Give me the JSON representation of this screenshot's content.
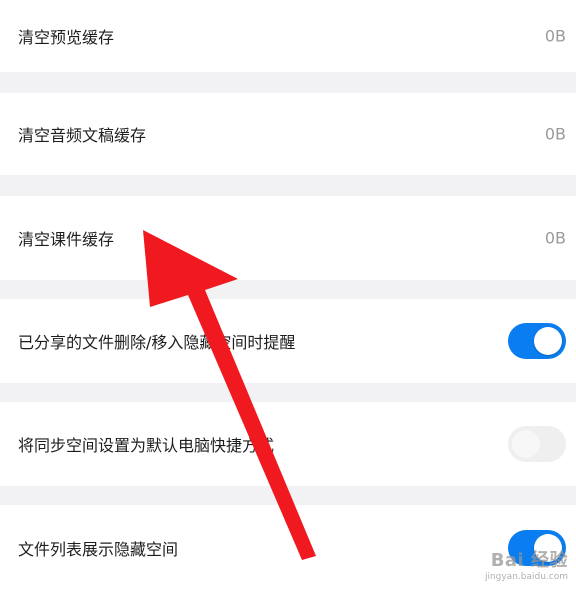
{
  "settings": {
    "items": [
      {
        "label": "清空预览缓存",
        "value": "0B"
      },
      {
        "label": "清空音频文稿缓存",
        "value": "0B"
      },
      {
        "label": "清空课件缓存",
        "value": "0B"
      },
      {
        "label": "已分享的文件删除/移入隐藏空间时提醒",
        "toggle": "on"
      },
      {
        "label": "将同步空间设置为默认电脑快捷方式",
        "toggle": "off"
      },
      {
        "label": "文件列表展示隐藏空间",
        "toggle": "on"
      }
    ]
  },
  "colors": {
    "toggle_on": "#0a7df0",
    "toggle_off": "#efefef",
    "arrow": "#f0191f",
    "page_bg": "#f2f2f4"
  },
  "watermark": {
    "main": "Bai 经验",
    "sub": "jingyan.baidu.com"
  }
}
